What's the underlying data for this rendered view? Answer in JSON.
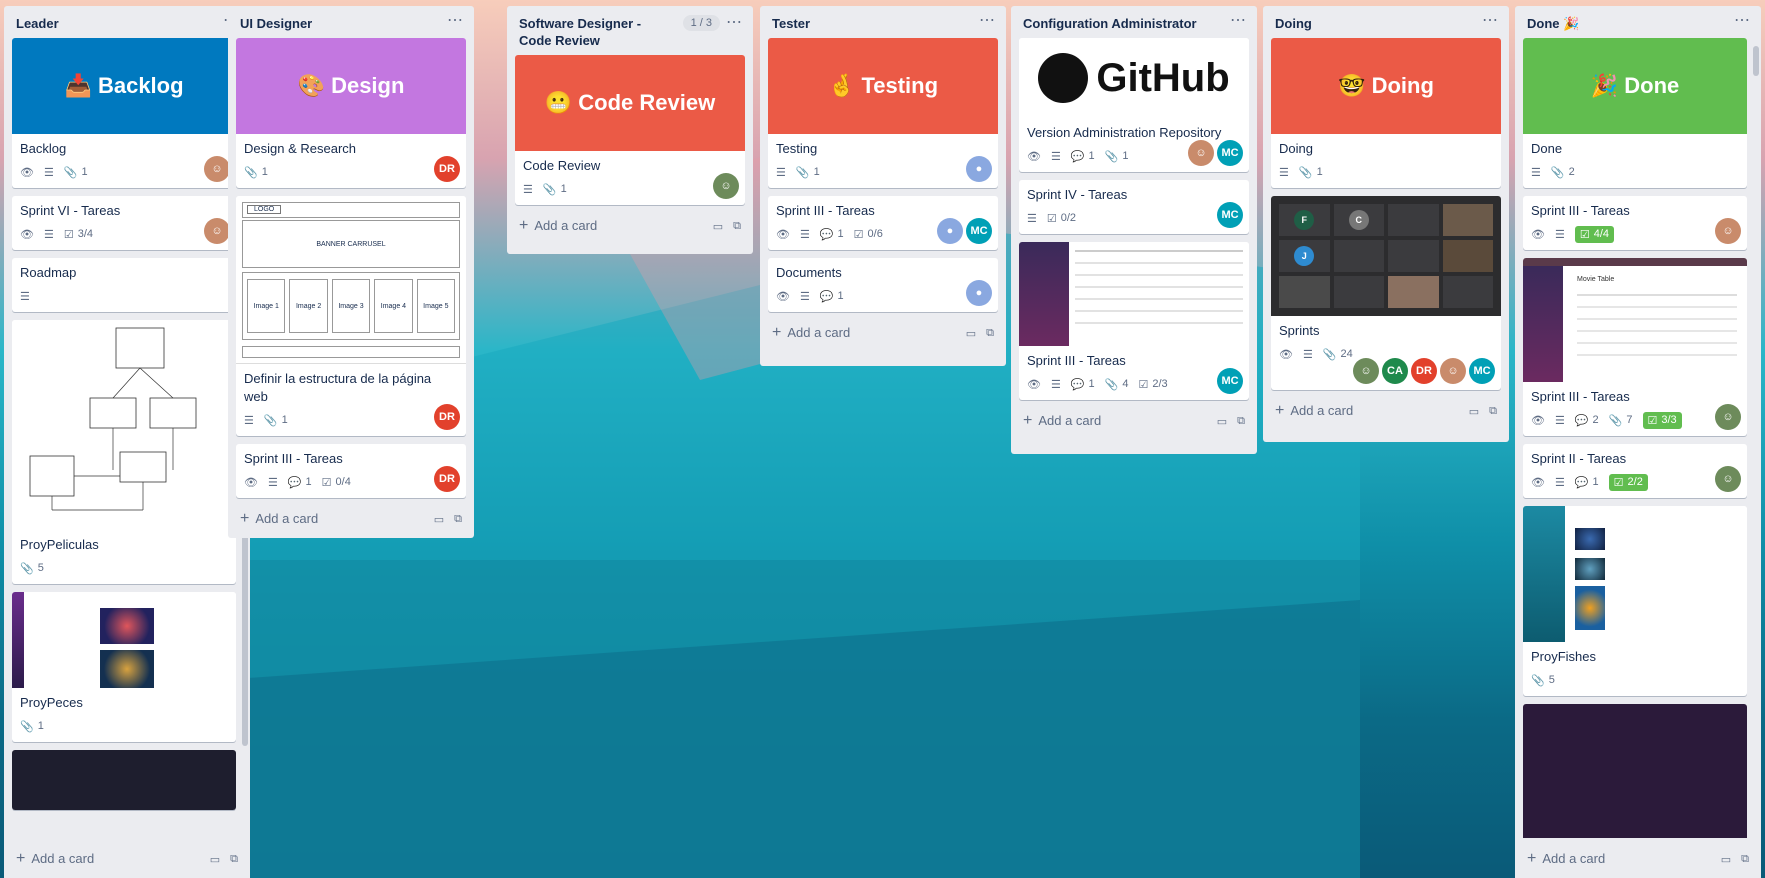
{
  "lists": [
    {
      "title": "Leader",
      "cards": [
        {
          "cover_label": "📥 Backlog",
          "title": "Backlog",
          "attachments": "1"
        },
        {
          "title": "Sprint VI - Tareas",
          "checklist": "3/4"
        },
        {
          "title": "Roadmap"
        },
        {
          "title": "ProyPeliculas",
          "attachments": "5"
        },
        {
          "title": "ProyPeces",
          "attachments": "1"
        }
      ],
      "add_label": "Add a card"
    },
    {
      "title": "UI Designer",
      "cards": [
        {
          "cover_label": "🎨 Design",
          "title": "Design & Research",
          "attachments": "1",
          "member": "DR"
        },
        {
          "title": "Definir la estructura de la página web",
          "attachments": "1",
          "member": "DR",
          "wireframe": {
            "logo": "LOGO",
            "banner": "BANNER CARRUSEL",
            "images": [
              "Image 1",
              "Image 2",
              "Image 3",
              "Image 4",
              "Image 5"
            ]
          }
        },
        {
          "title": "Sprint III - Tareas",
          "comments": "1",
          "checklist": "0/4",
          "member": "DR"
        }
      ],
      "add_label": "Add a card"
    },
    {
      "title": "Software Designer - Code Review",
      "count": "1 / 3",
      "cards": [
        {
          "cover_label": "😬 Code Review",
          "title": "Code Review",
          "attachments": "1"
        }
      ],
      "add_label": "Add a card"
    },
    {
      "title": "Tester",
      "cards": [
        {
          "cover_label": "🤞 Testing",
          "title": "Testing",
          "attachments": "1"
        },
        {
          "title": "Sprint III - Tareas",
          "comments": "1",
          "checklist": "0/6",
          "member": "MC"
        },
        {
          "title": "Documents",
          "comments": "1"
        }
      ],
      "add_label": "Add a card"
    },
    {
      "title": "Configuration Administrator",
      "cards": [
        {
          "cover_label": "GitHub",
          "title": "Version Administration Repository",
          "comments": "1",
          "attachments": "1",
          "member": "MC"
        },
        {
          "title": "Sprint IV - Tareas",
          "checklist": "0/2",
          "member": "MC"
        },
        {
          "title": "Sprint III - Tareas",
          "comments": "1",
          "attachments": "4",
          "checklist": "2/3",
          "member": "MC"
        }
      ],
      "add_label": "Add a card"
    },
    {
      "title": "Doing",
      "cards": [
        {
          "cover_label": "🤓 Doing",
          "title": "Doing",
          "attachments": "1"
        },
        {
          "title": "Sprints",
          "attachments": "24",
          "members": [
            "CA",
            "DR",
            "MC"
          ],
          "video_tiles": [
            "F",
            "C",
            "J"
          ]
        }
      ],
      "add_label": "Add a card"
    },
    {
      "title": "Done 🎉",
      "cards": [
        {
          "cover_label": "🎉 Done",
          "title": "Done",
          "attachments": "2"
        },
        {
          "title": "Sprint III - Tareas",
          "checklist": "4/4"
        },
        {
          "title": "Sprint III - Tareas",
          "comments": "2",
          "attachments": "7",
          "checklist": "3/3",
          "thumb_title": "Movie Table"
        },
        {
          "title": "Sprint II - Tareas",
          "comments": "1",
          "checklist": "2/2"
        },
        {
          "title": "ProyFishes",
          "attachments": "5"
        }
      ],
      "add_label": "Add a card"
    }
  ],
  "colors": {
    "blue": "#0079bf",
    "purple": "#c377e0",
    "red": "#eb5a46",
    "green": "#61bd4f",
    "avatar_red": "#e2412c",
    "avatar_teal": "#00a0b6",
    "avatar_green": "#1f8a4c"
  },
  "icons": [
    "eye-icon",
    "description-icon",
    "attachment-icon",
    "comment-icon",
    "checklist-icon",
    "menu-dots-icon",
    "template-icon",
    "card-template-icon"
  ]
}
